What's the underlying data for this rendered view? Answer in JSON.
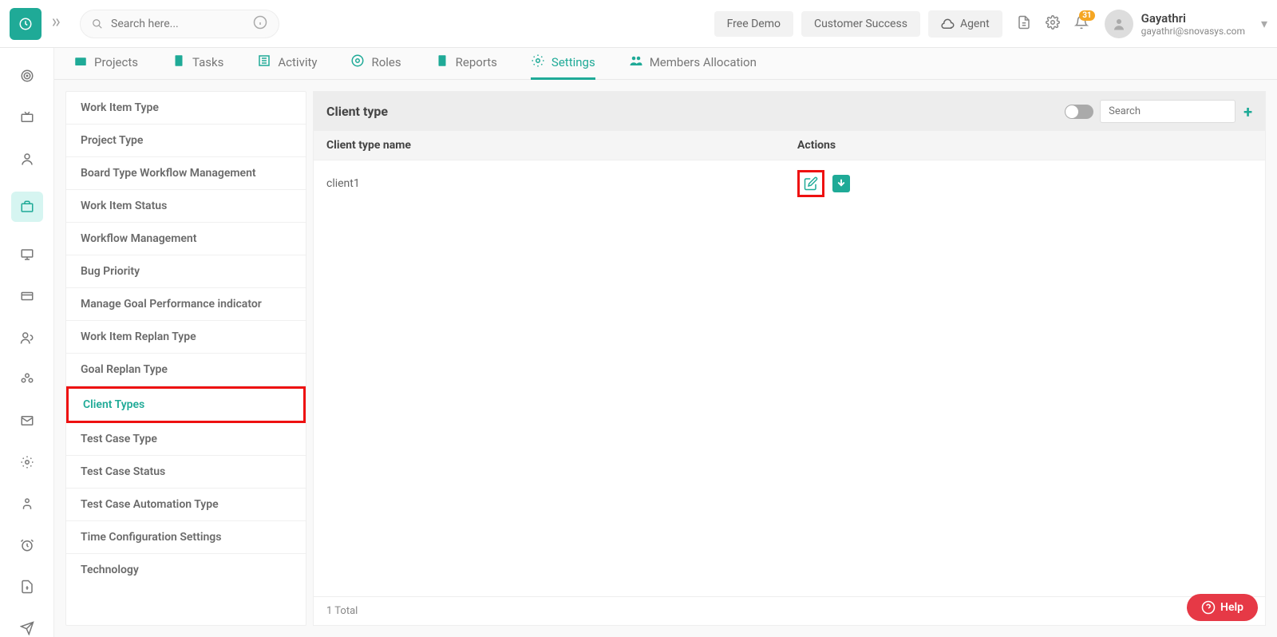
{
  "header": {
    "search_placeholder": "Search here...",
    "buttons": {
      "free_demo": "Free Demo",
      "customer_success": "Customer Success",
      "agent": "Agent"
    },
    "notif_count": "31",
    "user": {
      "name": "Gayathri",
      "email": "gayathri@snovasys.com"
    }
  },
  "subnav": {
    "projects": "Projects",
    "tasks": "Tasks",
    "activity": "Activity",
    "roles": "Roles",
    "reports": "Reports",
    "settings": "Settings",
    "members": "Members Allocation"
  },
  "settings_panel": [
    "Work Item Type",
    "Project Type",
    "Board Type Workflow Management",
    "Work Item Status",
    "Workflow Management",
    "Bug Priority",
    "Manage Goal Performance indicator",
    "Work Item Replan Type",
    "Goal Replan Type",
    "Client Types",
    "Test Case Type",
    "Test Case Status",
    "Test Case Automation Type",
    "Time Configuration Settings",
    "Technology"
  ],
  "main": {
    "title": "Client type",
    "search_placeholder": "Search",
    "col_name": "Client type name",
    "col_actions": "Actions",
    "rows": [
      {
        "name": "client1"
      }
    ],
    "footer": "1 Total"
  },
  "help": "Help"
}
